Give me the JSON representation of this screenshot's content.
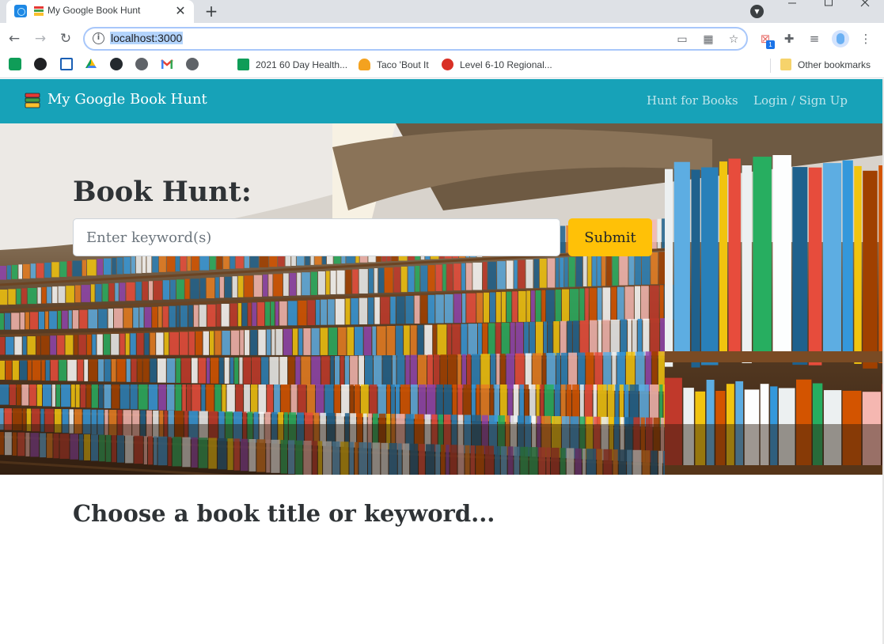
{
  "browser": {
    "tab_title": "My Google Book Hunt",
    "close_glyph": "✕",
    "newtab_glyph": "+",
    "url": "localhost:3000",
    "extension_badge": "1"
  },
  "bookmarks": [
    {
      "label": "2021 60 Day Health...",
      "color": "#0f9d58"
    },
    {
      "label": "Taco 'Bout It",
      "color": "#f4a21f"
    },
    {
      "label": "Level 6-10 Regional...",
      "color": "#d93025"
    },
    {
      "label": "Other bookmarks",
      "color": "#f6d36b"
    }
  ],
  "navbar": {
    "brand": "My Google Book Hunt",
    "links": [
      "Hunt for Books",
      "Login / Sign Up"
    ],
    "color": "#17a2b8"
  },
  "hero": {
    "title": "Book Hunt:",
    "search_placeholder": "Enter keyword(s)",
    "submit_label": "Submit",
    "button_color": "#ffc107"
  },
  "main": {
    "prompt": "Choose a book title or keyword..."
  }
}
